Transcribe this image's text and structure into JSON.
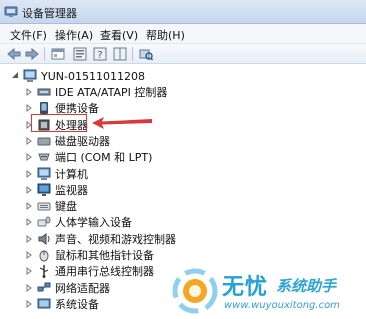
{
  "window": {
    "title": "设备管理器",
    "icon": "device-manager-icon"
  },
  "menu": [
    "文件(F)",
    "操作(A)",
    "查看(V)",
    "帮助(H)"
  ],
  "toolbar": {
    "buttons": [
      "back-arrow-icon",
      "forward-arrow-icon",
      "show-hide-console-icon",
      "properties-icon",
      "help-icon",
      "scan-hardware-icon"
    ]
  },
  "tree": {
    "root": "YUN-01511011208",
    "items": [
      {
        "label": "IDE ATA/ATAPI 控制器",
        "icon": "ide-controller-icon"
      },
      {
        "label": "便携设备",
        "icon": "portable-device-icon"
      },
      {
        "label": "处理器",
        "icon": "processor-icon",
        "highlighted": true
      },
      {
        "label": "磁盘驱动器",
        "icon": "disk-drive-icon"
      },
      {
        "label": "端口 (COM 和 LPT)",
        "icon": "port-icon"
      },
      {
        "label": "计算机",
        "icon": "computer-icon"
      },
      {
        "label": "监视器",
        "icon": "monitor-icon"
      },
      {
        "label": "键盘",
        "icon": "keyboard-icon"
      },
      {
        "label": "人体学输入设备",
        "icon": "hid-icon"
      },
      {
        "label": "声音、视频和游戏控制器",
        "icon": "sound-icon"
      },
      {
        "label": "鼠标和其他指针设备",
        "icon": "mouse-icon"
      },
      {
        "label": "通用串行总线控制器",
        "icon": "usb-icon"
      },
      {
        "label": "网络适配器",
        "icon": "network-icon"
      },
      {
        "label": "系统设备",
        "icon": "system-device-icon"
      }
    ]
  },
  "annotation": {
    "color": "#d83a3a"
  },
  "watermark": {
    "brand": "无忧",
    "brand2": "系统助手",
    "url": "www.wuyouxitong.com",
    "color": "#26a0d8"
  }
}
